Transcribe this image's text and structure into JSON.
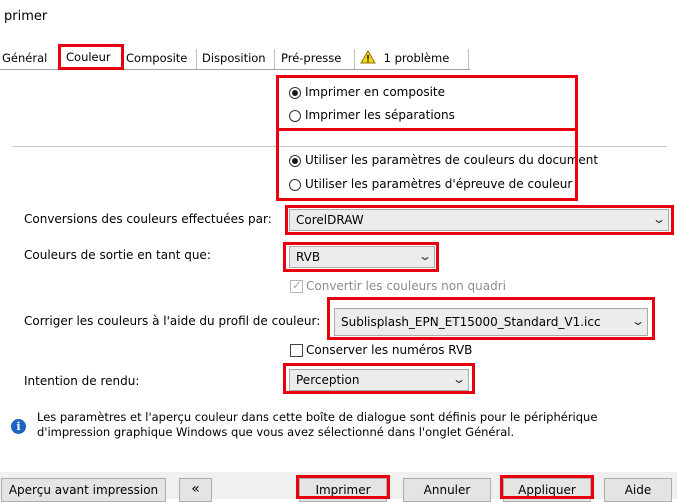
{
  "window": {
    "title": "primer"
  },
  "tabs": [
    {
      "label": "Général"
    },
    {
      "label": "Couleur"
    },
    {
      "label": "Composite"
    },
    {
      "label": "Disposition"
    },
    {
      "label": "Pré-presse"
    },
    {
      "label": "1 problème"
    }
  ],
  "output_mode": {
    "composite": "Imprimer en composite",
    "separations": "Imprimer les séparations",
    "selected": "composite"
  },
  "color_settings": {
    "document": "Utiliser les paramètres de couleurs du document",
    "proof": "Utiliser les paramètres d'épreuve de couleur",
    "selected": "document"
  },
  "conversions": {
    "label": "Conversions des couleurs effectuées par:",
    "value": "CorelDRAW"
  },
  "output_colors": {
    "label": "Couleurs de sortie en tant que:",
    "value": "RVB"
  },
  "convert_non_quadri": {
    "label": "Convertir les couleurs non quadri",
    "checked": true,
    "enabled": false
  },
  "profile": {
    "label": "Corriger les couleurs à l'aide du profil de couleur:",
    "value": "Sublisplash_EPN_ET15000_Standard_V1.icc"
  },
  "keep_rgb": {
    "label": "Conserver les numéros RVB",
    "checked": false
  },
  "rendering_intent": {
    "label": "Intention de rendu:",
    "value": "Perception"
  },
  "info": {
    "line1": "Les paramètres et l'aperçu couleur dans cette boîte de dialogue sont définis pour le périphérique",
    "line2": "d'impression graphique Windows que vous avez sélectionné dans l'onglet Général."
  },
  "buttons": {
    "preview": "Aperçu avant impression",
    "collapse": "«",
    "print": "Imprimer",
    "cancel": "Annuler",
    "apply": "Appliquer",
    "help": "Aide"
  },
  "colors": {
    "highlight": "#e8000e",
    "info": "#1d63c2",
    "warning": "#f5d800"
  }
}
